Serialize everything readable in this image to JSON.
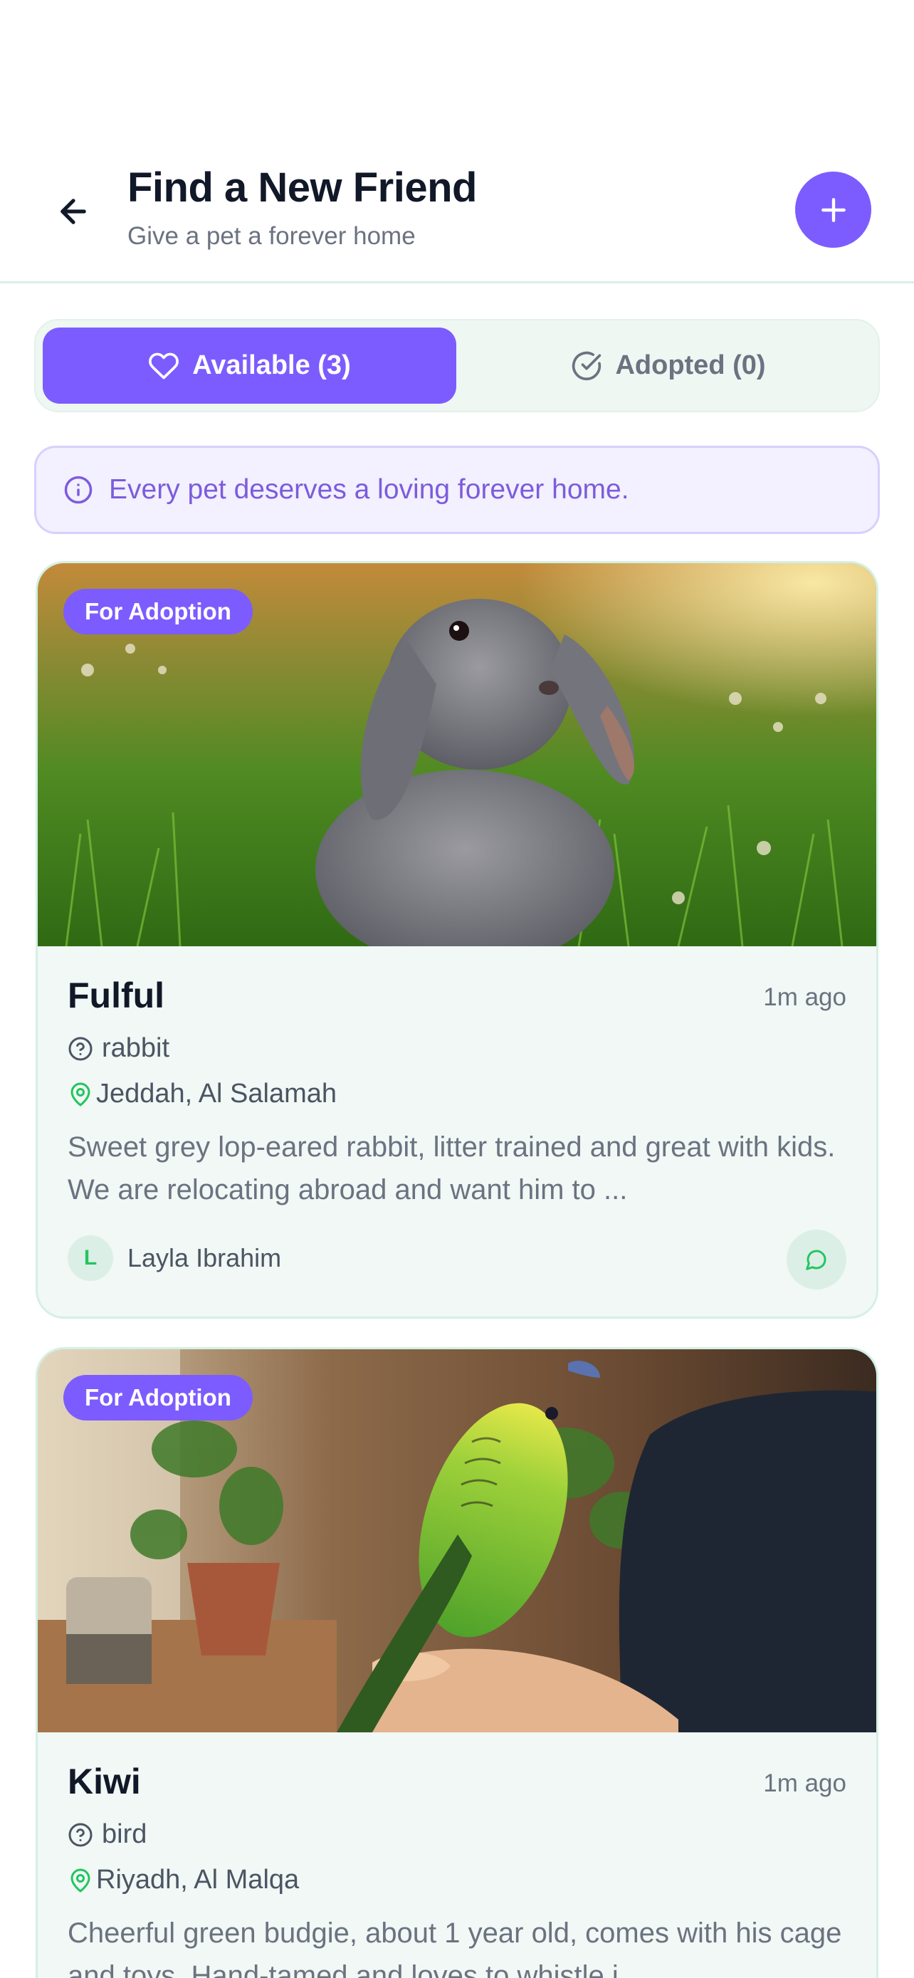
{
  "header": {
    "title": "Find a New Friend",
    "subtitle": "Give a pet a forever home",
    "back_icon": "arrow-left-icon",
    "add_icon": "plus-icon"
  },
  "tabs": [
    {
      "label": "Available (3)",
      "icon": "heart-icon",
      "active": true
    },
    {
      "label": "Adopted (0)",
      "icon": "check-circle-icon",
      "active": false
    }
  ],
  "info_banner": {
    "icon": "info-icon",
    "text": "Every pet deserves a loving forever home."
  },
  "pets": [
    {
      "badge": "For Adoption",
      "name": "Fulful",
      "time_ago": "1m ago",
      "species": "rabbit",
      "location": "Jeddah, Al Salamah",
      "description": "Sweet grey lop-eared rabbit, litter trained and great with kids. We are relocating abroad and want him to ...",
      "owner_initial": "L",
      "owner_name": "Layla Ibrahim"
    },
    {
      "badge": "For Adoption",
      "name": "Kiwi",
      "time_ago": "1m ago",
      "species": "bird",
      "location": "Riyadh, Al Malqa",
      "description": "Cheerful green budgie, about 1 year old, comes with his cage and toys. Hand-tamed and loves to whistle i..."
    }
  ],
  "colors": {
    "primary": "#7c5cff",
    "card_bg": "#f1f8f5",
    "card_border": "#d4f0e4",
    "accent_green": "#22c55e",
    "info_bg": "#f3f0ff"
  }
}
